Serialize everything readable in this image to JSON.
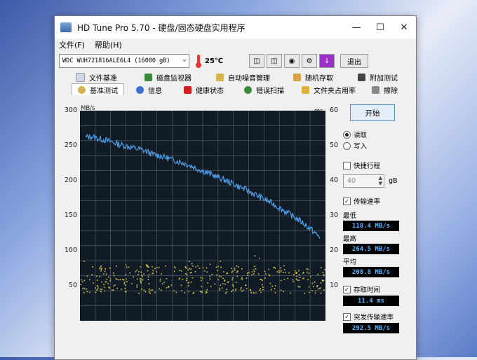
{
  "window": {
    "title": "HD Tune Pro 5.70 - 硬盘/固态硬盘实用程序"
  },
  "menu": {
    "file": "文件(F)",
    "help": "帮助(H)"
  },
  "toolbar": {
    "drive": "WDC  WUH721816ALE6L4 (16000 gB)",
    "temperature": "25℃",
    "exit": "退出"
  },
  "tabs": {
    "row1": [
      "文件基准",
      "磁盘监视器",
      "自动噪音管理",
      "随机存取",
      "附加测试"
    ],
    "row2": [
      "基准测试",
      "信息",
      "健康状态",
      "错误扫描",
      "文件夹占用率",
      "擦除"
    ]
  },
  "chart_data": {
    "type": "line",
    "ylabel_left": "MB/s",
    "ylabel_right": "ms",
    "yticks_left": [
      "300",
      "250",
      "200",
      "150",
      "100",
      "50"
    ],
    "yticks_right": [
      "60",
      "50",
      "40",
      "30",
      "20",
      "10"
    ],
    "ylim_left": [
      0,
      300
    ],
    "ylim_right": [
      0,
      60
    ],
    "grid": true,
    "series": [
      {
        "values": [
          262,
          263,
          260,
          258,
          255,
          252,
          250,
          247,
          245,
          242,
          238,
          236,
          233,
          230,
          227,
          224,
          220,
          216,
          212,
          208,
          204,
          200,
          196,
          191,
          187,
          182,
          177,
          172,
          167,
          161,
          155,
          149,
          143,
          136,
          128,
          118
        ]
      }
    ],
    "scatter_range_ms": [
      8,
      16
    ]
  },
  "panel": {
    "start": "开始",
    "read": "读取",
    "write": "写入",
    "quick": "快捷行程",
    "quick_value": "40",
    "quick_unit": "gB",
    "transfer": "传输速率",
    "min_label": "最低",
    "min_value": "118.4 MB/s",
    "max_label": "最高",
    "max_value": "264.5 MB/s",
    "avg_label": "平均",
    "avg_value": "208.8 MB/s",
    "access_label": "存取时间",
    "access_value": "11.4 ms",
    "burst_label": "突发传输速率",
    "burst_value": "292.5 MB/s"
  }
}
